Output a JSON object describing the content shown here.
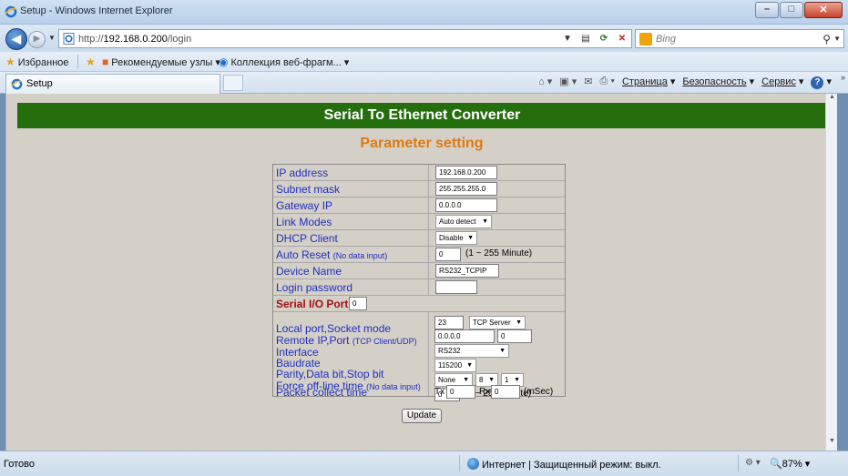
{
  "window": {
    "title": "Setup - Windows Internet Explorer"
  },
  "address": {
    "url_prefix": "http://",
    "url_host": "192.168.0.200",
    "url_path": "/login",
    "search_placeholder": "Bing"
  },
  "favorites": {
    "label": "Избранное",
    "suggested": "Рекомендуемые узлы ▾",
    "gallery": "Коллекция веб-фрагм... ▾"
  },
  "tab": {
    "label": "Setup"
  },
  "commands": {
    "page": "Страница",
    "safety": "Безопасность",
    "tools": "Сервис"
  },
  "page": {
    "banner": "Serial To Ethernet Converter",
    "subtitle": "Parameter setting",
    "fields": {
      "ip_label": "IP address",
      "ip_value": "192.168.0.200",
      "subnet_label": "Subnet mask",
      "subnet_value": "255.255.255.0",
      "gateway_label": "Gateway IP",
      "gateway_value": "0.0.0.0",
      "link_label": "Link Modes",
      "link_value": "Auto detect",
      "dhcp_label": "DHCP Client",
      "dhcp_value": "Disable",
      "autoreset_label": "Auto Reset",
      "autoreset_note": "(No data input)",
      "autoreset_value": "0",
      "autoreset_range": "(1 ~ 255 Minute)",
      "device_label": "Device Name",
      "device_value": "RS232_TCPIP",
      "password_label": "Login password",
      "password_value": "",
      "serial_label": "Serial I/O Port",
      "serial_value": "0",
      "localport_label": "Local port,Socket mode",
      "localport_value": "23",
      "socket_mode": "TCP Server",
      "remote_label": "Remote IP,Port",
      "remote_note": "(TCP Client/UDP)",
      "remote_ip": "0.0.0.0",
      "remote_port": "0",
      "interface_label": "Interface",
      "interface_value": "RS232",
      "baud_label": "Baudrate",
      "baud_value": "115200",
      "parity_label": "Parity,Data bit,Stop bit",
      "parity_value": "None",
      "databit_value": "8",
      "stopbit_value": "1",
      "offline_label": "Force off-line time",
      "offline_note": "(No data input)",
      "offline_value": "0",
      "offline_range": "(1 ~ 255 Minute)",
      "packet_label": "Packet collect time",
      "tx_label": "Tx",
      "tx_value": "0",
      "rx_label": "Rx",
      "rx_value": "0",
      "packet_unit": "(mSec)"
    },
    "update_button": "Update"
  },
  "status": {
    "text": "Готово",
    "zone": "Интернет | Защищенный режим: выкл.",
    "zoom": "87%"
  }
}
